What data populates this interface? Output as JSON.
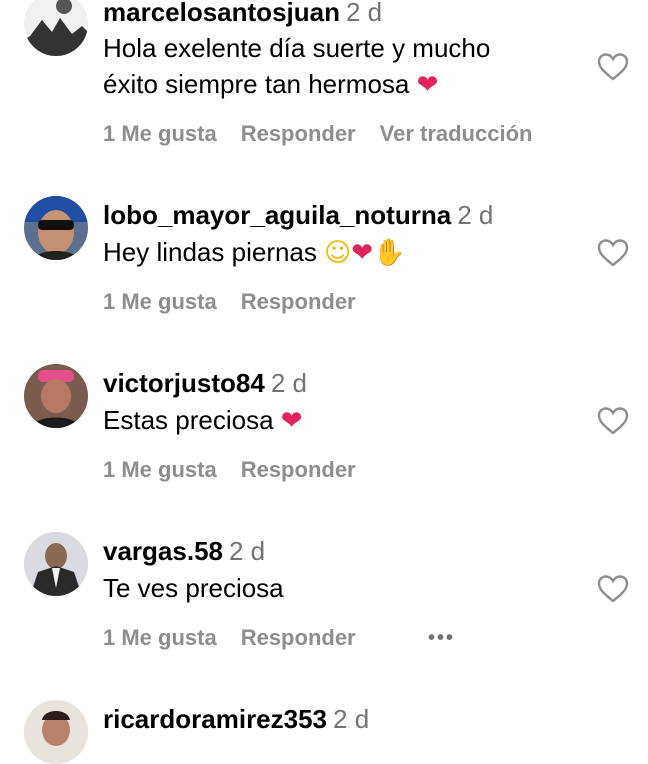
{
  "comments": [
    {
      "username": "marcelosantosjuan",
      "time": "2 d",
      "text": "Hola exelente día suerte y mucho",
      "text2": "éxito siempre tan hermosa",
      "emoji2": "❤",
      "likes": "1 Me gusta",
      "reply": "Responder",
      "translate": "Ver traducción"
    },
    {
      "username": "lobo_mayor_aguila_noturna",
      "time": "2 d",
      "text": "Hey lindas piernas",
      "emoji_a": "☺",
      "emoji_b": "❤",
      "emoji_c": "✋",
      "likes": "1 Me gusta",
      "reply": "Responder"
    },
    {
      "username": "victorjusto84",
      "time": "2 d",
      "text": "Estas preciosa",
      "emoji": "❤",
      "likes": "1 Me gusta",
      "reply": "Responder"
    },
    {
      "username": "vargas.58",
      "time": "2 d",
      "text": "Te ves preciosa",
      "likes": "1 Me gusta",
      "reply": "Responder",
      "more": "•••"
    },
    {
      "username": "ricardoramirez353",
      "time": "2 d"
    }
  ],
  "icons": {
    "heart": "heart-outline-icon",
    "more": "more-options-icon"
  },
  "colors": {
    "muted": "#8e8e8e",
    "time": "#737373",
    "heart_emoji": "#e0245e"
  }
}
